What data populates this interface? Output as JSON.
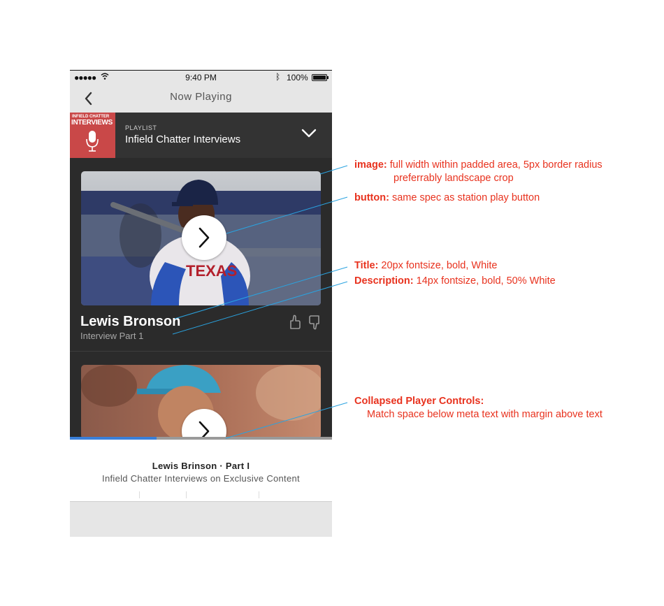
{
  "status_bar": {
    "signal": "●●●●●",
    "time": "9:40 PM",
    "battery_pct": "100%"
  },
  "nav": {
    "title": "Now Playing",
    "back_icon": "chevron-left-icon"
  },
  "playlist": {
    "label": "PLAYLIST",
    "title": "Infield Chatter Interviews",
    "art_top": "INFIELD CHATTER",
    "art_main": "INTERVIEWS",
    "toggle_icon": "chevron-down-icon",
    "art_color": "#c94848"
  },
  "items": [
    {
      "title": "Lewis Bronson",
      "description": "Interview Part 1"
    }
  ],
  "player": {
    "now_title": "Lewis Brinson · Part I",
    "now_sub": "Infield Chatter Interviews on Exclusive Content",
    "progress": 0.33,
    "progress_color": "#3a7fd9"
  },
  "annotations": {
    "image_label": "image:",
    "image_text": "full width within padded area, 5px border radius",
    "image_text2": "preferrably landscape crop",
    "button_label": "button:",
    "button_text": "same spec as station play button",
    "title_label": "Title:",
    "title_text": "20px fontsize, bold, White",
    "desc_label": "Description:",
    "desc_text": "14px fontsize, bold, 50% White",
    "collapsed_label": "Collapsed Player Controls:",
    "collapsed_text": "Match space below meta text with margin above text",
    "color": "#e8321e",
    "line_color": "#2aa3e0"
  }
}
